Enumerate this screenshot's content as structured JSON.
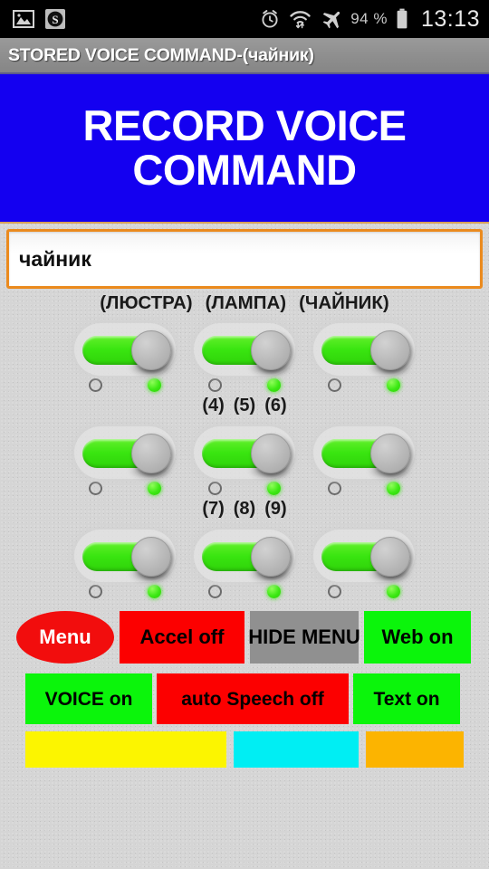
{
  "statusbar": {
    "left_icons": [
      {
        "name": "image-icon",
        "glyph": "image"
      },
      {
        "name": "skype-icon",
        "glyph": "s-badge"
      }
    ],
    "right_icons": [
      {
        "name": "alarm-clock-icon",
        "glyph": "alarm"
      },
      {
        "name": "wifi-transfer-icon",
        "glyph": "wifi"
      },
      {
        "name": "airplane-mode-icon",
        "glyph": "airplane"
      }
    ],
    "battery_percent": "94 %",
    "battery_icon": "battery-icon",
    "clock": "13:13"
  },
  "titlebar": {
    "title": "STORED VOICE COMMAND-(чайник)"
  },
  "banner": {
    "title": "RECORD VOICE COMMAND",
    "bg_color": "#1400f0",
    "text_color": "#ffffff"
  },
  "voice_field": {
    "value": "чайник",
    "placeholder": "",
    "border_color": "#eb8a1d"
  },
  "sections": [
    {
      "id": "section-1",
      "labels": [
        "(ЛЮСТРА)",
        "(ЛАМПА)",
        "(ЧАЙНИК)"
      ],
      "switches": [
        {
          "name": "switch-lyustra",
          "state": "on",
          "led_left": "off",
          "led_right": "on"
        },
        {
          "name": "switch-lampa",
          "state": "on",
          "led_left": "off",
          "led_right": "on"
        },
        {
          "name": "switch-chaynik",
          "state": "on",
          "led_left": "off",
          "led_right": "on"
        }
      ]
    },
    {
      "id": "section-2",
      "labels": [
        "(4)",
        "(5)",
        "(6)"
      ],
      "switches": [
        {
          "name": "switch-4",
          "state": "on",
          "led_left": "off",
          "led_right": "on"
        },
        {
          "name": "switch-5",
          "state": "on",
          "led_left": "off",
          "led_right": "on"
        },
        {
          "name": "switch-6",
          "state": "on",
          "led_left": "off",
          "led_right": "on"
        }
      ]
    },
    {
      "id": "section-3",
      "labels": [
        "(7)",
        "(8)",
        "(9)"
      ],
      "switches": [
        {
          "name": "switch-7",
          "state": "on",
          "led_left": "off",
          "led_right": "on"
        },
        {
          "name": "switch-8",
          "state": "on",
          "led_left": "off",
          "led_right": "on"
        },
        {
          "name": "switch-9",
          "state": "on",
          "led_left": "off",
          "led_right": "on"
        }
      ]
    }
  ],
  "buttons": {
    "menu": {
      "label": "Menu",
      "color": "#f20d0d",
      "text_color": "#ffffff"
    },
    "accel": {
      "label": "Accel off",
      "color": "#fc0000",
      "text_color": "#000000"
    },
    "hide_menu": {
      "label": "HIDE MENU",
      "color": "#909090",
      "text_color": "#000000"
    },
    "web": {
      "label": "Web on",
      "color": "#0bf50b",
      "text_color": "#000000"
    },
    "voice": {
      "label": "VOICE on",
      "color": "#0bf50b",
      "text_color": "#000000"
    },
    "auto_speech": {
      "label": "auto Speech off",
      "color": "#fc0000",
      "text_color": "#000000"
    },
    "text": {
      "label": "Text on",
      "color": "#0bf50b",
      "text_color": "#000000"
    },
    "yellow": {
      "label": "",
      "color": "#fcf500"
    },
    "cyan": {
      "label": "",
      "color": "#00eef3"
    },
    "orange": {
      "label": "",
      "color": "#fcb400"
    }
  }
}
